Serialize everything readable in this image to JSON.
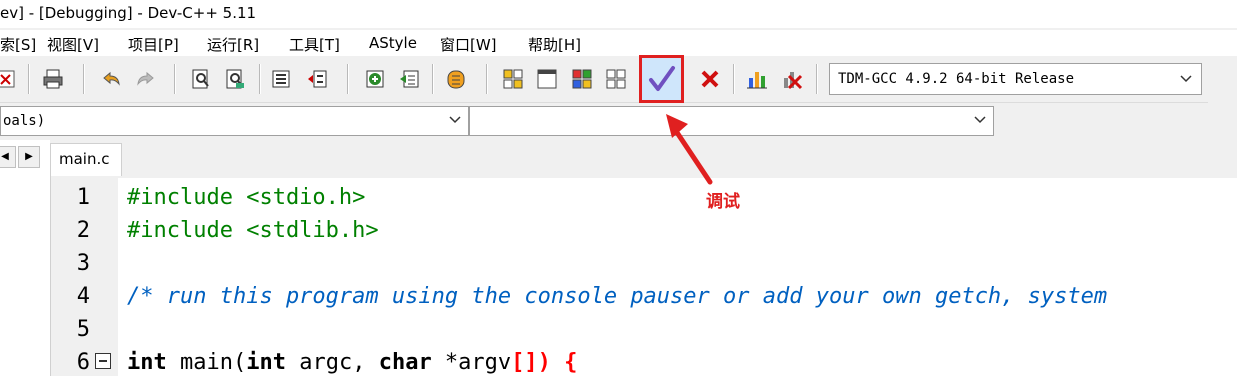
{
  "window": {
    "title": "ev] - [Debugging] - Dev-C++ 5.11"
  },
  "menu": {
    "items": [
      "索[S]",
      "视图[V]",
      "项目[P]",
      "运行[R]",
      "工具[T]",
      "AStyle",
      "窗口[W]",
      "帮助[H]"
    ]
  },
  "toolbar": {
    "debug_icon": "check-icon",
    "compiler_select": "TDM-GCC 4.9.2 64-bit Release"
  },
  "class_combo": {
    "value": "oals)"
  },
  "member_combo": {
    "value": ""
  },
  "tabs": [
    {
      "label": "main.c"
    }
  ],
  "editor": {
    "line_numbers": [
      "1",
      "2",
      "3",
      "4",
      "5",
      "6"
    ],
    "lines": {
      "l1": "#include <stdio.h>",
      "l2": "#include <stdlib.h>",
      "l4": "/* run this program using the console pauser or add your own getch, system",
      "l6_kw1": "int",
      "l6_a": " main(",
      "l6_kw2": "int",
      "l6_b": " argc, ",
      "l6_kw3": "char",
      "l6_c": " *argv",
      "l6_d": "[]) {"
    }
  },
  "annotation": {
    "label": "调试",
    "color": "#e02020"
  }
}
